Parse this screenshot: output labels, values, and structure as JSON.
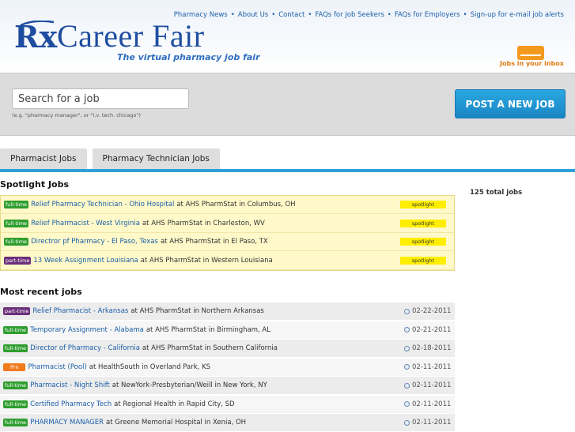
{
  "brand": {
    "logo_rx": "Rx",
    "logo_text": "Career Fair",
    "tagline": "The virtual pharmacy job fair",
    "inbox_label": "Jobs in your inbox",
    "accent": "#1f4ea0",
    "action_color": "#1a86c4"
  },
  "topnav": [
    "Pharmacy News",
    "About Us",
    "Contact",
    "FAQs for Job Seekers",
    "FAQs for Employers",
    "Sign-up for e-mail job alerts"
  ],
  "search": {
    "placeholder": "Search for a job",
    "hint": "(e.g. \"pharmacy manager\", or \"i.v. tech. chicago\")",
    "post_button": "POST A NEW JOB"
  },
  "tabs": [
    "Pharmacist Jobs",
    "Pharmacy Technician Jobs"
  ],
  "spotlight": {
    "title": "Spotlight Jobs",
    "tag": "spotlight",
    "jobs": [
      {
        "type": "full-time",
        "title": "Relief Pharmacy Technician - Ohio Hospital",
        "company": "AHS PharmStat",
        "location": "Columbus, OH"
      },
      {
        "type": "full-time",
        "title": "Relief Pharmacist - West Virginia",
        "company": "AHS PharmStat",
        "location": "Charleston, WV"
      },
      {
        "type": "full-time",
        "title": "Directror pf Pharmacy - El Paso, Texas",
        "company": "AHS PharmStat",
        "location": "El Paso, TX"
      },
      {
        "type": "part-time",
        "title": "13 Week Assignment Louisiana",
        "company": "AHS PharmStat",
        "location": "Western Louisiana"
      }
    ]
  },
  "total_jobs": "125 total jobs",
  "recent": {
    "title": "Most recent jobs",
    "jobs": [
      {
        "type": "part-time",
        "title": "Relief Pharmacist - Arkansas",
        "company": "AHS PharmStat",
        "location": "Northern Arkansas",
        "date": "02-22-2011"
      },
      {
        "type": "full-time",
        "title": "Temporary Assignment - Alabama",
        "company": "AHS PharmStat",
        "location": "Birmingham, AL",
        "date": "02-21-2011"
      },
      {
        "type": "full-time",
        "title": "Director of Pharmacy - California",
        "company": "AHS PharmStat",
        "location": "Southern California",
        "date": "02-18-2011"
      },
      {
        "type": "Prn",
        "title": "Pharmacist (Pool)",
        "company": "HealthSouth",
        "location": "Overland Park, KS",
        "date": "02-11-2011"
      },
      {
        "type": "full-time",
        "title": "Pharmacist - Night Shift",
        "company": "NewYork-Presbyterian/Weill",
        "location": "New York, NY",
        "date": "02-11-2011"
      },
      {
        "type": "full-time",
        "title": "Certified Pharmacy Tech",
        "company": "Regional Health",
        "location": "Rapid City, SD",
        "date": "02-11-2011"
      },
      {
        "type": "full-time",
        "title": "PHARMACY MANAGER",
        "company": "Greene Memorial Hospital",
        "location": "Xenia, OH",
        "date": "02-11-2011"
      }
    ]
  },
  "words": {
    "at": "at",
    "in": "in"
  }
}
